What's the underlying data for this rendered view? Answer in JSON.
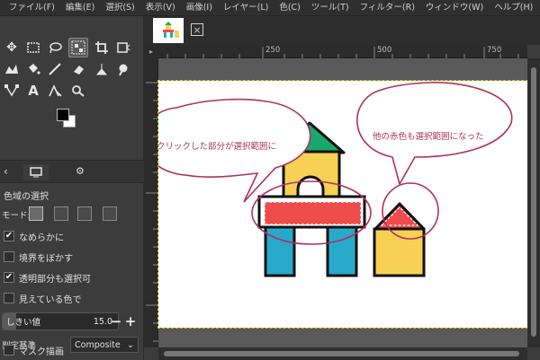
{
  "menu": [
    "ファイル(F)",
    "編集(E)",
    "選択(S)",
    "表示(V)",
    "画像(I)",
    "レイヤー(L)",
    "色(C)",
    "ツール(T)",
    "フィルター(R)",
    "ウィンドウ(W)",
    "ヘルプ(H)"
  ],
  "tool_options": {
    "title": "色域の選択",
    "mode_label": "モード:",
    "antialias": {
      "label": "なめらかに",
      "checked": true
    },
    "feather": {
      "label": "境界をぼかす",
      "checked": false
    },
    "transparent": {
      "label": "透明部分も選択可",
      "checked": true
    },
    "sample_merged": {
      "label": "見えている色で",
      "checked": false
    },
    "threshold": {
      "label": "しきい値",
      "value": "15.0",
      "fraction": 0.12
    },
    "criterion": {
      "label": "判定基準",
      "value": "Composite"
    },
    "draw_mask": {
      "label": "マスク描画",
      "checked": false
    }
  },
  "ruler": {
    "top_labels": [
      "250",
      "500",
      "750"
    ]
  },
  "annotations": {
    "left": "クリックした部分が選択範囲に",
    "right": "他の赤色も選択範囲になった"
  },
  "colors": {
    "annotation": "#b03060",
    "red": "#f04b4b",
    "yellow": "#f7d154",
    "blue": "#29a9c9",
    "green": "#1aa86a"
  }
}
